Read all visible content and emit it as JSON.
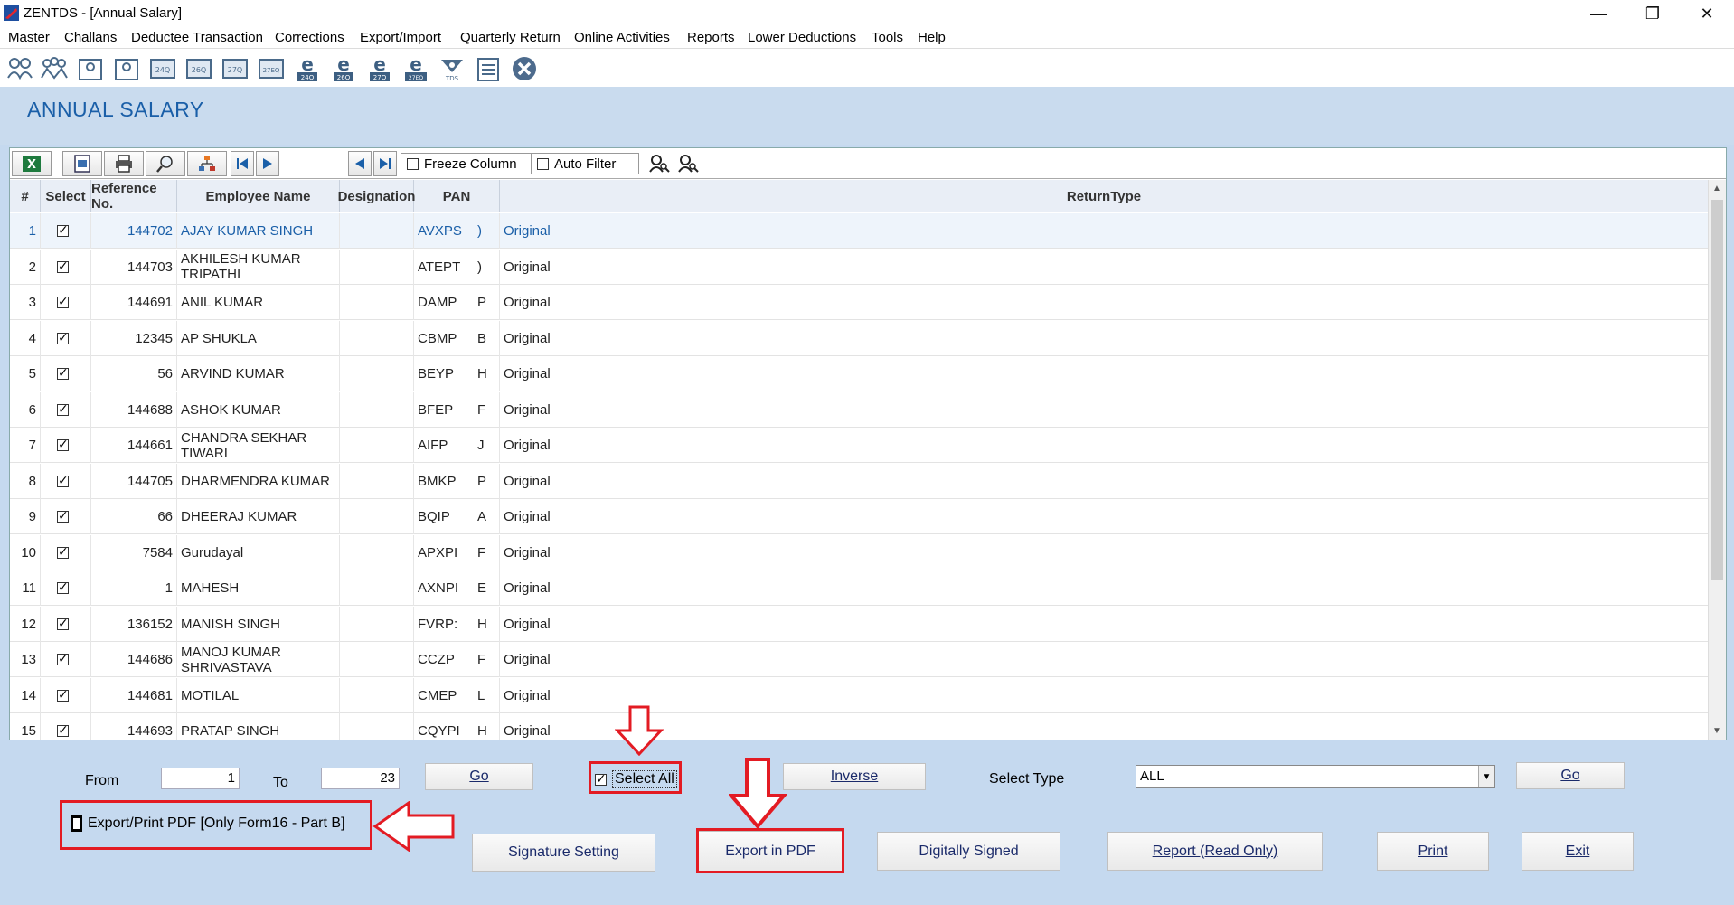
{
  "window": {
    "title": "ZENTDS - [Annual Salary]",
    "minimize": "—",
    "maximize": "❐",
    "close": "✕"
  },
  "menu": [
    "Master",
    "Challans",
    "Deductee Transaction",
    "Corrections",
    "Export/Import",
    "Quarterly Return",
    "Online Activities",
    "Reports",
    "Lower Deductions",
    "Tools",
    "Help"
  ],
  "page": {
    "title": "ANNUAL SALARY"
  },
  "grid_toolbar": {
    "freeze_column": "Freeze Column",
    "auto_filter": "Auto Filter"
  },
  "table": {
    "headers": {
      "num": "#",
      "select": "Select",
      "ref": "Reference No.",
      "name": "Employee Name",
      "designation": "Designation",
      "pan": "PAN",
      "return_type": "ReturnType"
    },
    "rows": [
      {
        "num": "1",
        "ref": "144702",
        "name": "AJAY KUMAR SINGH",
        "designation": "",
        "pan": "AVXPS",
        "pan_tail": ")",
        "return_type": "Original"
      },
      {
        "num": "2",
        "ref": "144703",
        "name": "AKHILESH KUMAR TRIPATHI",
        "designation": "",
        "pan": "ATEPT",
        "pan_tail": ")",
        "return_type": "Original"
      },
      {
        "num": "3",
        "ref": "144691",
        "name": "ANIL KUMAR",
        "designation": "",
        "pan": "DAMP",
        "pan_tail": "P",
        "return_type": "Original"
      },
      {
        "num": "4",
        "ref": "12345",
        "name": "AP SHUKLA",
        "designation": "",
        "pan": "CBMP",
        "pan_tail": "B",
        "return_type": "Original"
      },
      {
        "num": "5",
        "ref": "56",
        "name": "ARVIND KUMAR",
        "designation": "",
        "pan": "BEYP",
        "pan_tail": "H",
        "return_type": "Original"
      },
      {
        "num": "6",
        "ref": "144688",
        "name": "ASHOK KUMAR",
        "designation": "",
        "pan": "BFEP",
        "pan_tail": "F",
        "return_type": "Original"
      },
      {
        "num": "7",
        "ref": "144661",
        "name": "CHANDRA SEKHAR TIWARI",
        "designation": "",
        "pan": "AIFP",
        "pan_tail": "J",
        "return_type": "Original"
      },
      {
        "num": "8",
        "ref": "144705",
        "name": "DHARMENDRA KUMAR",
        "designation": "",
        "pan": "BMKP",
        "pan_tail": "P",
        "return_type": "Original"
      },
      {
        "num": "9",
        "ref": "66",
        "name": "DHEERAJ KUMAR",
        "designation": "",
        "pan": "BQIP",
        "pan_tail": "A",
        "return_type": "Original"
      },
      {
        "num": "10",
        "ref": "7584",
        "name": "Gurudayal",
        "designation": "",
        "pan": "APXPI",
        "pan_tail": "F",
        "return_type": "Original"
      },
      {
        "num": "11",
        "ref": "1",
        "name": "MAHESH",
        "designation": "",
        "pan": "AXNPI",
        "pan_tail": "E",
        "return_type": "Original"
      },
      {
        "num": "12",
        "ref": "136152",
        "name": "MANISH SINGH",
        "designation": "",
        "pan": "FVRP:",
        "pan_tail": "H",
        "return_type": "Original"
      },
      {
        "num": "13",
        "ref": "144686",
        "name": "MANOJ KUMAR SHRIVASTAVA",
        "designation": "",
        "pan": "CCZP",
        "pan_tail": "F",
        "return_type": "Original"
      },
      {
        "num": "14",
        "ref": "144681",
        "name": "MOTILAL",
        "designation": "",
        "pan": "CMEP",
        "pan_tail": "L",
        "return_type": "Original"
      },
      {
        "num": "15",
        "ref": "144693",
        "name": "PRATAP SINGH",
        "designation": "",
        "pan": "CQYPI",
        "pan_tail": "H",
        "return_type": "Original"
      }
    ]
  },
  "bottom": {
    "from_label": "From",
    "from_value": "1",
    "to_label": "To",
    "to_value": "23",
    "go1": "Go",
    "select_all": "Select All",
    "inverse": "Inverse",
    "select_type_label": "Select Type",
    "select_type_value": "ALL",
    "go2": "Go",
    "export_print_option": "Export/Print PDF [Only Form16 - Part B]",
    "signature_setting": "Signature Setting",
    "export_pdf": "Export in PDF",
    "digitally_signed": "Digitally Signed",
    "report_read_only": "Report (Read Only)",
    "print": "Print",
    "exit": "Exit"
  },
  "colors": {
    "accent": "#1a5fa8",
    "highlight": "#e31b23",
    "panel_bg": "#c5d9ef"
  }
}
